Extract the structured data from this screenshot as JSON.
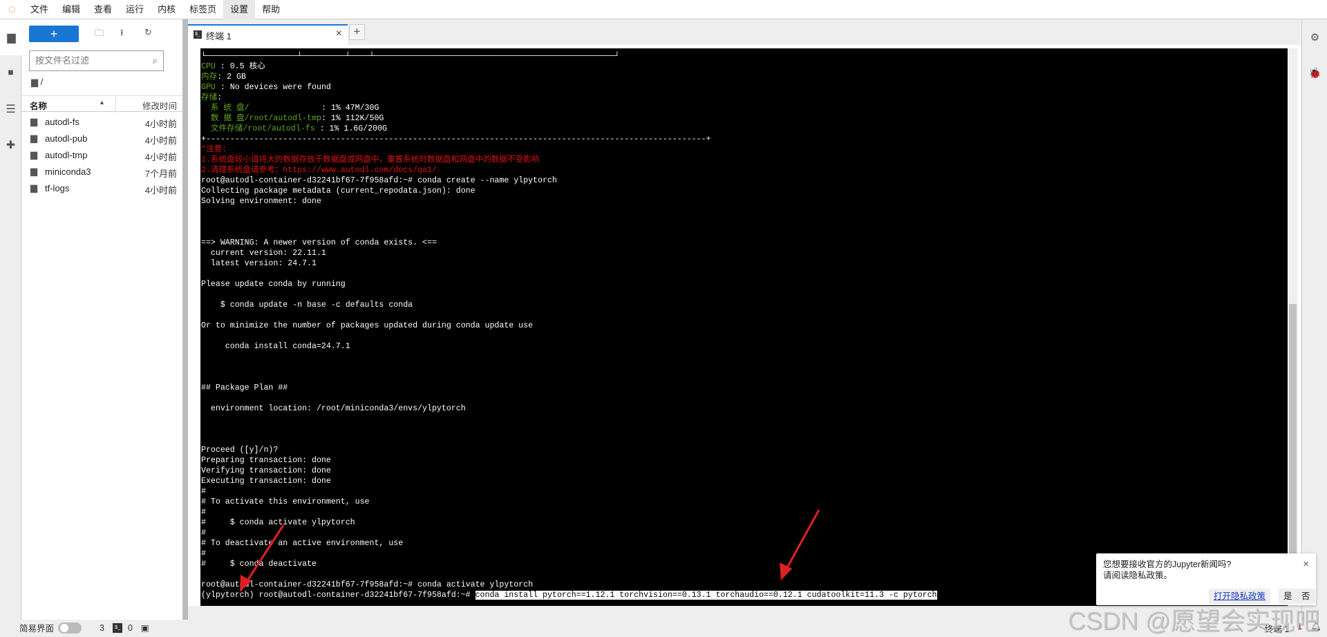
{
  "menu": [
    "文件",
    "编辑",
    "查看",
    "运行",
    "内核",
    "标签页",
    "设置",
    "帮助"
  ],
  "menu_active": "设置",
  "file_panel": {
    "new_label": "+",
    "filter_placeholder": "按文件名过滤",
    "breadcrumb": "/",
    "col_name": "名称",
    "col_modified": "修改时间",
    "items": [
      {
        "name": "autodl-fs",
        "modified": "4小时前"
      },
      {
        "name": "autodl-pub",
        "modified": "4小时前"
      },
      {
        "name": "autodl-tmp",
        "modified": "4小时前"
      },
      {
        "name": "miniconda3",
        "modified": "7个月前"
      },
      {
        "name": "tf-logs",
        "modified": "4小时前"
      }
    ]
  },
  "tab": {
    "label": "终端 1",
    "icon_text": "$_",
    "add": "+",
    "close": "×"
  },
  "colors": {
    "green": "#5fa81e",
    "red": "#e01010",
    "accent": "#1976d2",
    "white": "#ffffff"
  },
  "terminal": {
    "lines": [
      [
        {
          "t": "└───────────────────┴─────────┴────┴──────────────────────────────────────────────────┘",
          "c": "white"
        }
      ],
      [
        {
          "t": "CPU ",
          "c": "green"
        },
        {
          "t": ": 0.5 核心",
          "c": "white"
        }
      ],
      [
        {
          "t": "内存",
          "c": "green"
        },
        {
          "t": ": 2 GB",
          "c": "white"
        }
      ],
      [
        {
          "t": "GPU ",
          "c": "green"
        },
        {
          "t": ": No devices were found",
          "c": "white"
        }
      ],
      [
        {
          "t": "存储",
          "c": "green"
        },
        {
          "t": ":",
          "c": "white"
        }
      ],
      [
        {
          "t": "  系 统 盘/               ",
          "c": "green"
        },
        {
          "t": ": 1% 47M/30G",
          "c": "white"
        }
      ],
      [
        {
          "t": "  数 据 盘/root/autodl-tmp",
          "c": "green"
        },
        {
          "t": ": 1% 112K/50G",
          "c": "white"
        }
      ],
      [
        {
          "t": "  文件存储/root/autodl-fs ",
          "c": "green"
        },
        {
          "t": ": 1% 1.6G/200G",
          "c": "white"
        }
      ],
      [
        {
          "t": "+--------------------------------------------------------------------------------------------------------+",
          "c": "white"
        }
      ],
      [
        {
          "t": "*注意:",
          "c": "red"
        }
      ],
      [
        {
          "t": "1.系统盘较小请将大的数据存放于数据盘或网盘中，重置系统时数据盘和网盘中的数据不受影响",
          "c": "red"
        }
      ],
      [
        {
          "t": "2.清理系统盘请参考：https://www.autodl.com/docs/qa1/",
          "c": "red"
        }
      ],
      [
        {
          "t": "root@autodl-container-d32241bf67-7f958afd:~# conda create --name ylpytorch",
          "c": "white"
        }
      ],
      [
        {
          "t": "Collecting package metadata (current_repodata.json): done",
          "c": "white"
        }
      ],
      [
        {
          "t": "Solving environment: done",
          "c": "white"
        }
      ],
      [],
      [],
      [],
      [
        {
          "t": "==> WARNING: A newer version of conda exists. <==",
          "c": "white"
        }
      ],
      [
        {
          "t": "  current version: 22.11.1",
          "c": "white"
        }
      ],
      [
        {
          "t": "  latest version: 24.7.1",
          "c": "white"
        }
      ],
      [],
      [
        {
          "t": "Please update conda by running",
          "c": "white"
        }
      ],
      [],
      [
        {
          "t": "    $ conda update -n base -c defaults conda",
          "c": "white"
        }
      ],
      [],
      [
        {
          "t": "Or to minimize the number of packages updated during conda update use",
          "c": "white"
        }
      ],
      [],
      [
        {
          "t": "     conda install conda=24.7.1",
          "c": "white"
        }
      ],
      [],
      [],
      [],
      [
        {
          "t": "## Package Plan ##",
          "c": "white"
        }
      ],
      [],
      [
        {
          "t": "  environment location: /root/miniconda3/envs/ylpytorch",
          "c": "white"
        }
      ],
      [],
      [],
      [],
      [
        {
          "t": "Proceed ([y]/n)?",
          "c": "white"
        }
      ],
      [
        {
          "t": "Preparing transaction: done",
          "c": "white"
        }
      ],
      [
        {
          "t": "Verifying transaction: done",
          "c": "white"
        }
      ],
      [
        {
          "t": "Executing transaction: done",
          "c": "white"
        }
      ],
      [
        {
          "t": "#",
          "c": "white"
        }
      ],
      [
        {
          "t": "# To activate this environment, use",
          "c": "white"
        }
      ],
      [
        {
          "t": "#",
          "c": "white"
        }
      ],
      [
        {
          "t": "#     $ conda activate ylpytorch",
          "c": "white"
        }
      ],
      [
        {
          "t": "#",
          "c": "white"
        }
      ],
      [
        {
          "t": "# To deactivate an active environment, use",
          "c": "white"
        }
      ],
      [
        {
          "t": "#",
          "c": "white"
        }
      ],
      [
        {
          "t": "#     $ conda deactivate",
          "c": "white"
        }
      ],
      [],
      [
        {
          "t": "root@autodl-container-d32241bf67-7f958afd:~# conda activate ylpytorch",
          "c": "white"
        }
      ],
      [
        {
          "t": "(ylpytorch) root@autodl-container-d32241bf67-7f958afd:~# ",
          "c": "white"
        },
        {
          "t": "conda install pytorch==1.12.1 torchvision==0.13.1 torchaudio==0.12.1 cudatoolkit=11.3 -c pytorch",
          "c": "selected"
        }
      ]
    ]
  },
  "status": {
    "simple_mode": "简易界面",
    "kernels": "3",
    "terminal_icon": "$_",
    "terminals": "0",
    "right_label": "终端 1",
    "right_count": "1"
  },
  "notification": {
    "line1": "您想要接收官方的Jupyter新闻吗?",
    "line2": "请阅读隐私政策。",
    "open_policy": "打开隐私政策",
    "yes": "是",
    "no": "否",
    "close": "×"
  },
  "watermark": "CSDN @愿望会实现吧"
}
